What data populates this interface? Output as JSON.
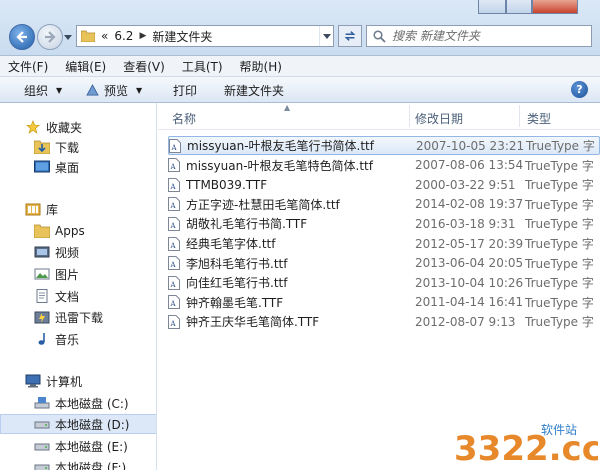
{
  "address": {
    "crumbs": [
      "«",
      "6.2",
      "新建文件夹"
    ],
    "search_placeholder": "搜索 新建文件夹"
  },
  "menu": [
    "文件(F)",
    "编辑(E)",
    "查看(V)",
    "工具(T)",
    "帮助(H)"
  ],
  "toolbar": {
    "organize": "组织",
    "preview": "预览",
    "print": "打印",
    "new_folder": "新建文件夹",
    "help": "?"
  },
  "nav": {
    "favorites": "收藏夹",
    "downloads": "下载",
    "desktop": "桌面",
    "library": "库",
    "apps": "Apps",
    "videos": "视频",
    "pictures": "图片",
    "documents": "文档",
    "thunder": "迅雷下载",
    "music": "音乐",
    "computer": "计算机",
    "disk_c": "本地磁盘 (C:)",
    "disk_d": "本地磁盘 (D:)",
    "disk_e": "本地磁盘 (E:)",
    "disk_f": "本地磁盘 (F:)"
  },
  "columns": {
    "name": "名称",
    "date": "修改日期",
    "type": "类型"
  },
  "files": [
    {
      "name": "missyuan-叶根友毛笔行书简体.ttf",
      "date": "2007-10-05 23:21",
      "type": "TrueType 字"
    },
    {
      "name": "missyuan-叶根友毛笔特色简体.ttf",
      "date": "2007-08-06 13:54",
      "type": "TrueType 字"
    },
    {
      "name": "TTMB039.TTF",
      "date": "2000-03-22 9:51",
      "type": "TrueType 字"
    },
    {
      "name": "方正字迹-杜慧田毛笔简体.ttf",
      "date": "2014-02-08 19:37",
      "type": "TrueType 字"
    },
    {
      "name": "胡敬礼毛笔行书简.TTF",
      "date": "2016-03-18 9:31",
      "type": "TrueType 字"
    },
    {
      "name": "经典毛笔字体.ttf",
      "date": "2012-05-17 20:39",
      "type": "TrueType 字"
    },
    {
      "name": "李旭科毛笔行书.ttf",
      "date": "2013-06-04 20:05",
      "type": "TrueType 字"
    },
    {
      "name": "向佳红毛笔行书.ttf",
      "date": "2013-10-04 10:26",
      "type": "TrueType 字"
    },
    {
      "name": "钟齐翰墨毛笔.TTF",
      "date": "2011-04-14 16:41",
      "type": "TrueType 字"
    },
    {
      "name": "钟齐王庆华毛笔简体.TTF",
      "date": "2012-08-07 9:13",
      "type": "TrueType 字"
    }
  ],
  "watermark": {
    "text": "3322.cc",
    "tag": "软件站"
  }
}
